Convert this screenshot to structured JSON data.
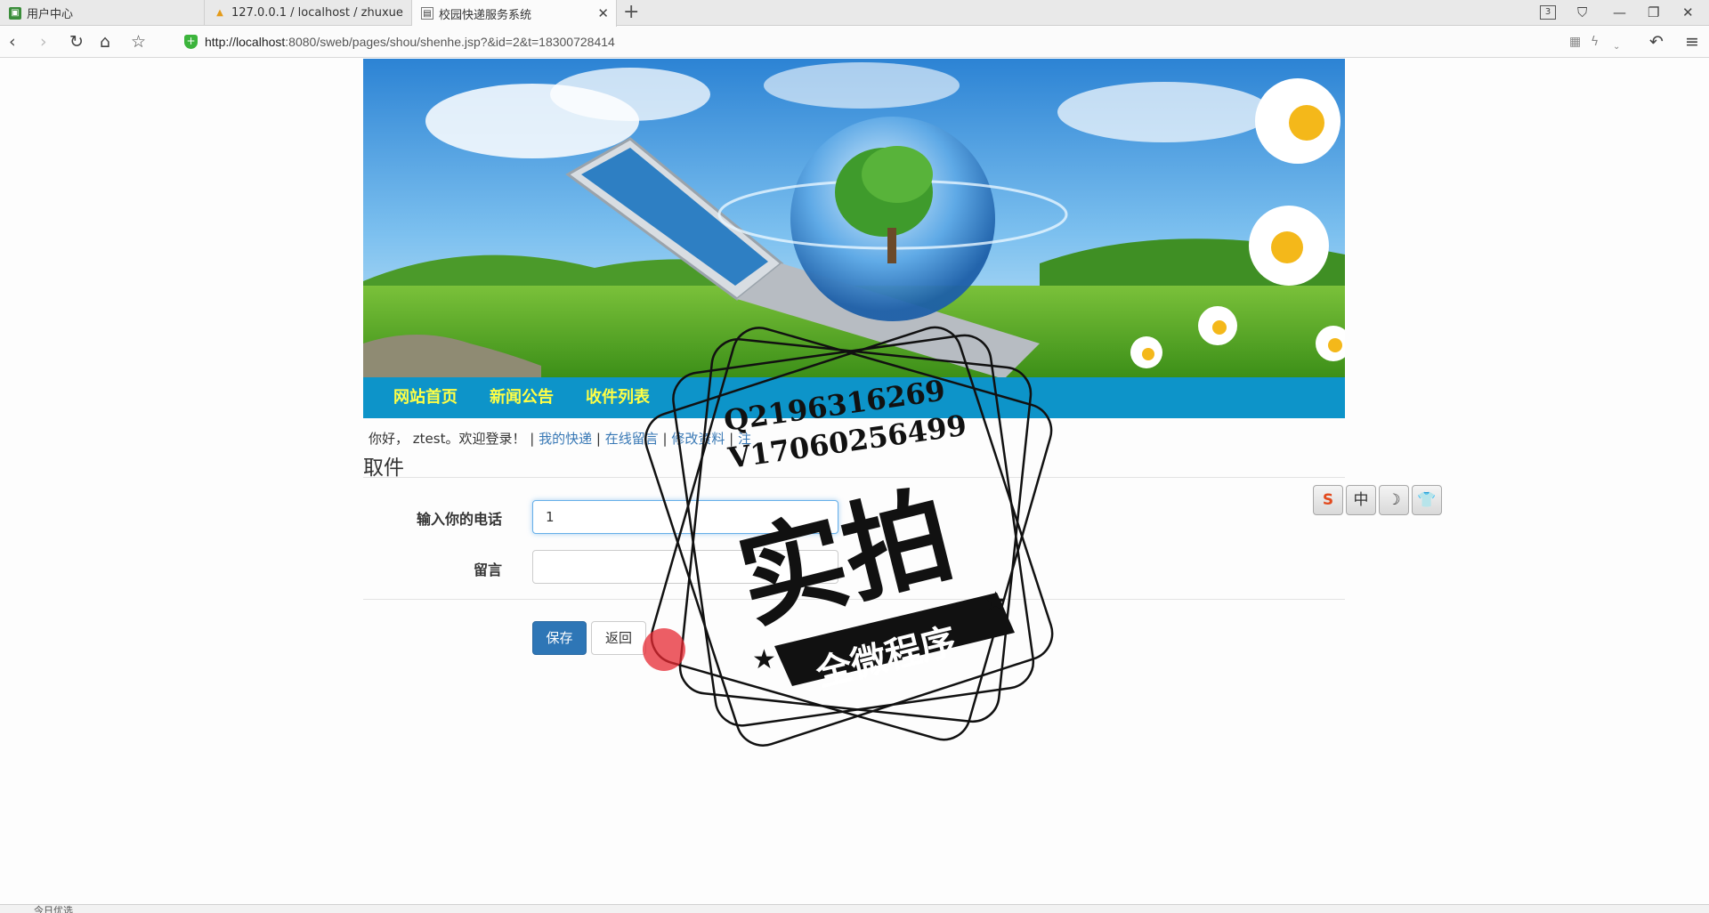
{
  "browser": {
    "tabs": [
      {
        "label": "用户中心",
        "icon": "user-center-favicon"
      },
      {
        "label": "127.0.0.1 / localhost / zhuxue",
        "icon": "phpmyadmin-favicon"
      },
      {
        "label": "校园快递服务系统",
        "icon": "page-favicon"
      }
    ],
    "tab_count_badge": "3",
    "url_host": "http://localhost",
    "url_rest": ":8080/sweb/pages/shou/shenhe.jsp?&id=2&t=18300728414"
  },
  "nav": {
    "items": [
      "网站首页",
      "新闻公告",
      "收件列表"
    ]
  },
  "welcome": {
    "greeting": "你好， ztest。欢迎登录！ |",
    "links": [
      "我的快递",
      "在线留言",
      "修改资料",
      "注"
    ],
    "sep": "|"
  },
  "form": {
    "title": "取件",
    "phone_label": "输入你的电话",
    "phone_value": "1",
    "message_label": "留言",
    "message_value": "",
    "save_label": "保存",
    "back_label": "返回"
  },
  "ime_toolbar": {
    "items": [
      {
        "label": "S",
        "icon": "sogou-logo-icon"
      },
      {
        "label": "中",
        "icon": "chinese-mode-icon"
      },
      {
        "label": "☽",
        "icon": "moon-icon"
      },
      {
        "label": "👕",
        "icon": "skin-shirt-icon"
      }
    ]
  },
  "watermark": {
    "contact_q": "Q2196316269",
    "contact_v": "V17060256499",
    "big_text": "实拍",
    "ribbon_text": "全微程序"
  },
  "statusbar": {
    "left_text": "今日优选"
  },
  "colors": {
    "nav_bg": "#0d94c9",
    "nav_text": "#ffff45",
    "primary_button": "#2e76b6",
    "link": "#3878b5"
  }
}
